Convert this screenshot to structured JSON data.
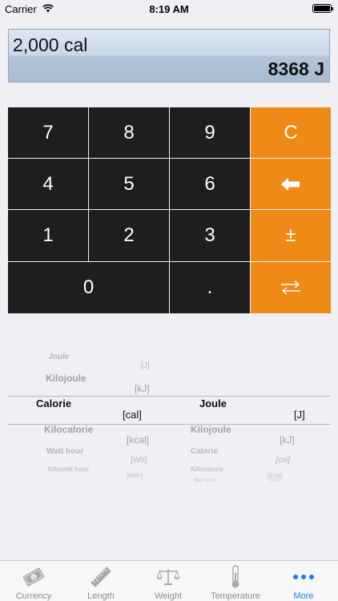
{
  "status_bar": {
    "carrier": "Carrier",
    "time": "8:19 AM"
  },
  "display": {
    "input": "2,000 cal",
    "result": "8368 J"
  },
  "keypad": {
    "keys": [
      "7",
      "8",
      "9",
      "C",
      "4",
      "5",
      "6",
      "1",
      "2",
      "3",
      "±",
      "0",
      "."
    ]
  },
  "picker": {
    "from": {
      "items": [
        {
          "name": "Joule",
          "unit": "[J]"
        },
        {
          "name": "Kilojoule",
          "unit": "[kJ]"
        },
        {
          "name": "Calorie",
          "unit": "[cal]"
        },
        {
          "name": "Kilocalorie",
          "unit": "[kcal]"
        },
        {
          "name": "Watt hour",
          "unit": "[Wh]"
        },
        {
          "name": "Kilowatt hour",
          "unit": "[kWh]"
        }
      ]
    },
    "to": {
      "items": [
        {
          "name": "Joule",
          "unit": "[J]"
        },
        {
          "name": "Kilojoule",
          "unit": "[kJ]"
        },
        {
          "name": "Calorie",
          "unit": "[cal]"
        },
        {
          "name": "Kilocalorie",
          "unit": "[kcal]"
        },
        {
          "name": "Watt hour",
          "unit": "[Wh]"
        }
      ]
    }
  },
  "tabs": [
    {
      "label": "Currency",
      "icon": "currency-icon"
    },
    {
      "label": "Length",
      "icon": "ruler-icon"
    },
    {
      "label": "Weight",
      "icon": "scale-icon"
    },
    {
      "label": "Temperature",
      "icon": "thermometer-icon"
    },
    {
      "label": "More",
      "icon": "more-icon",
      "active": true
    }
  ],
  "colors": {
    "accent": "#1f7cf2",
    "key_dark": "#1e1e1e",
    "key_orange": "#ef8a17"
  }
}
